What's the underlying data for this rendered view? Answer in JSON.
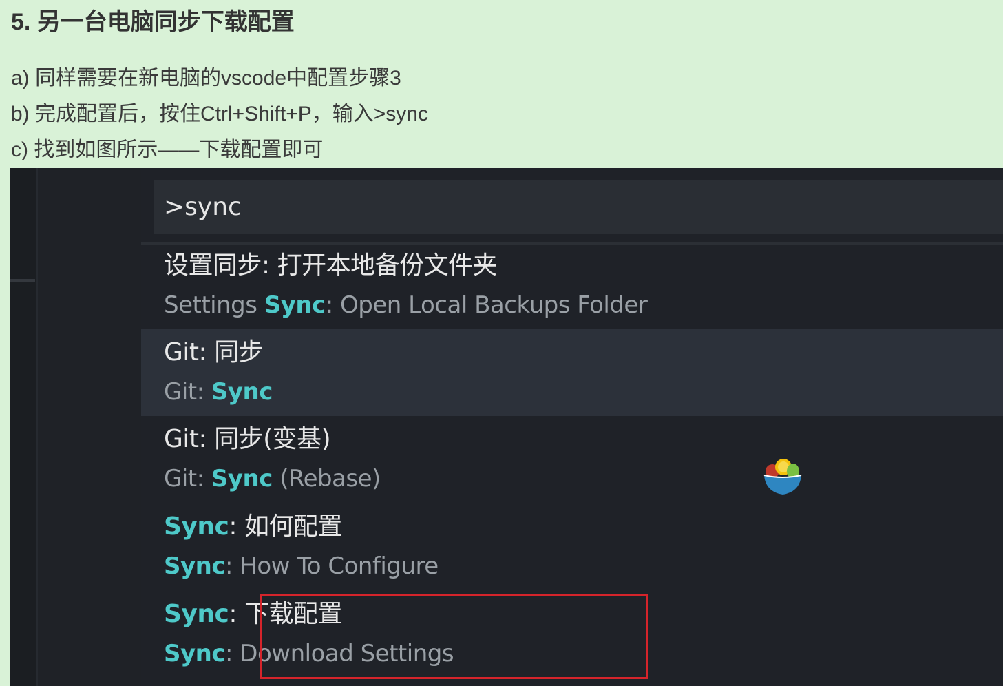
{
  "heading": "5. 另一台电脑同步下载配置",
  "steps": [
    "a) 同样需要在新电脑的vscode中配置步骤3",
    "b) 完成配置后，按住Ctrl+Shift+P，输入>sync",
    "c) 找到如图所示——下载配置即可"
  ],
  "palette": {
    "input_value": ">sync",
    "items": [
      {
        "zh_prefix": "设置同步: ",
        "zh_rest": "打开本地备份文件夹",
        "en_pre": "Settings ",
        "en_match": "Sync",
        "en_post": ": Open Local Backups Folder"
      },
      {
        "zh_prefix": "Git: ",
        "zh_rest": "同步",
        "en_pre": "Git: ",
        "en_match": "Sync",
        "en_post": ""
      },
      {
        "zh_prefix": "Git: ",
        "zh_rest": "同步(变基)",
        "en_pre": "Git: ",
        "en_match": "Sync",
        "en_post": " (Rebase)"
      },
      {
        "zh_match": "Sync",
        "zh_rest": ": 如何配置",
        "en_match": "Sync",
        "en_post": ": How To Configure"
      },
      {
        "zh_match": "Sync",
        "zh_rest": ": 下载配置",
        "en_match": "Sync",
        "en_post": ": Download Settings"
      }
    ]
  },
  "colors": {
    "page_background": "#d9f2d7",
    "editor_background": "#1e2227",
    "selected_row": "#2c313a",
    "match_highlight": "#4ec9c9",
    "annotation_box": "#d5242b"
  },
  "icons": {
    "watermark": "fruit-bowl-icon"
  }
}
